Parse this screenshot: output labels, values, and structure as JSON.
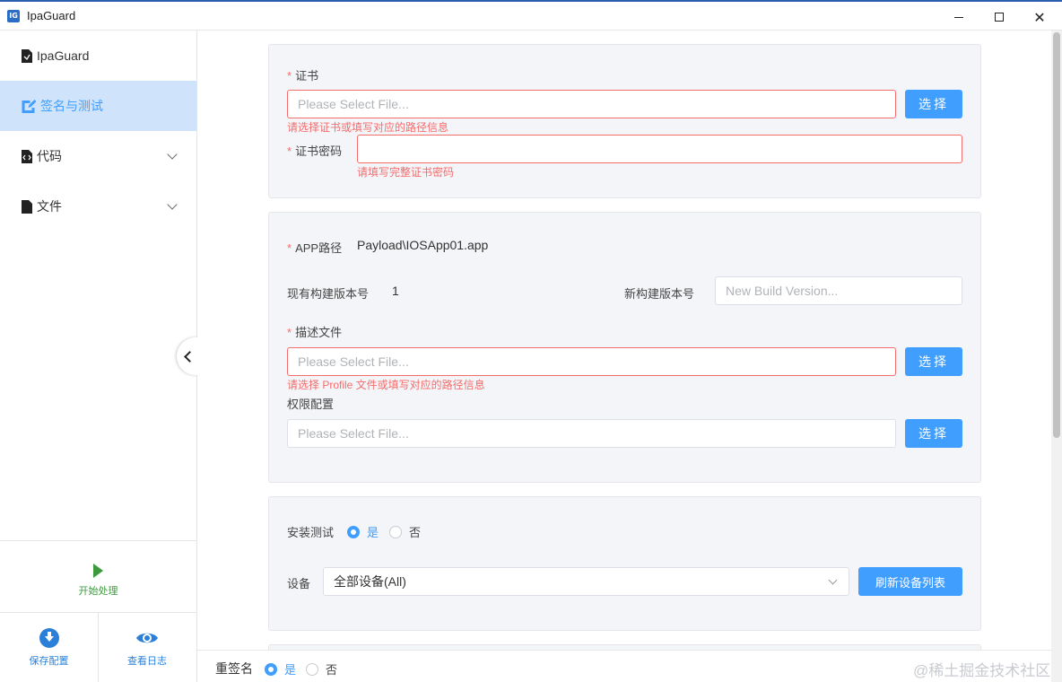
{
  "window": {
    "title": "IpaGuard",
    "app_icon_text": "IG",
    "min_label": "minimize",
    "max_label": "maximize",
    "close_glyph": "✕"
  },
  "sidebar": {
    "items": [
      {
        "label": "IpaGuard",
        "icon": "document-icon"
      },
      {
        "label": "签名与测试",
        "icon": "edit-icon",
        "active": true
      },
      {
        "label": "代码",
        "icon": "code-file-icon"
      },
      {
        "label": "文件",
        "icon": "file-icon"
      }
    ],
    "start_label": "开始处理",
    "save_label": "保存配置",
    "log_label": "查看日志"
  },
  "certificate": {
    "label": "证书",
    "placeholder": "Please Select File...",
    "error": "请选择证书或填写对应的路径信息",
    "button": "选择",
    "password_label": "证书密码",
    "password_error": "请填写完整证书密码"
  },
  "app": {
    "path_label": "APP路径",
    "path_value": "Payload\\IOSApp01.app",
    "current_build_label": "现有构建版本号",
    "current_build_value": "1",
    "new_build_label": "新构建版本号",
    "new_build_placeholder": "New Build Version...",
    "profile_label": "描述文件",
    "profile_placeholder": "Please Select File...",
    "profile_error": "请选择 Profile 文件或填写对应的路径信息",
    "profile_button": "选择",
    "entitlements_label": "权限配置",
    "entitlements_placeholder": "Please Select File...",
    "entitlements_button": "选择"
  },
  "install": {
    "label": "安装测试",
    "yes": "是",
    "no": "否",
    "device_label": "设备",
    "device_value": "全部设备(All)",
    "refresh_button": "刷新设备列表"
  },
  "resign": {
    "label": "重签名",
    "yes": "是",
    "no": "否"
  },
  "watermark": "@稀土掘金技术社区",
  "colors": {
    "accent": "#409eff",
    "error": "#f56c6c",
    "start": "#3c9a3c",
    "active_nav_bg": "#cfe3fa"
  }
}
